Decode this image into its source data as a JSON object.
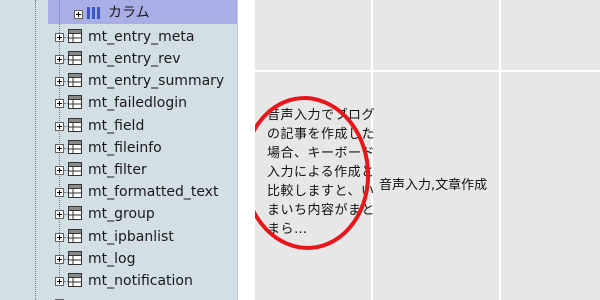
{
  "tree": {
    "column_node_label": "カラム",
    "tables": [
      "mt_entry_meta",
      "mt_entry_rev",
      "mt_entry_summary",
      "mt_failedlogin",
      "mt_field",
      "mt_fileinfo",
      "mt_filter",
      "mt_formatted_text",
      "mt_group",
      "mt_ipbanlist",
      "mt_log",
      "mt_notification"
    ]
  },
  "grid": {
    "description_cell": "音声入力でブログの記事を作成した場合、キーボード入力による作成と比較しますと、いまいち内容がまとまら…",
    "tags_cell": "音声入力,文章作成"
  },
  "colors": {
    "tree_background": "#d2dfe5",
    "selection_highlight": "#a9aee6",
    "cell_background": "#e7e7e7",
    "annotation_red": "#e8151b"
  }
}
